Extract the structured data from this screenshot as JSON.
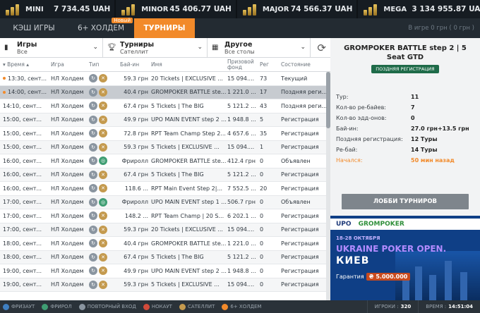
{
  "jackpots": [
    {
      "name": "MINI",
      "value": "7 734.45 UAH"
    },
    {
      "name": "MINOR",
      "value": "45 406.77 UAH"
    },
    {
      "name": "MAJOR",
      "value": "74 566.37 UAH"
    },
    {
      "name": "MEGA",
      "value": "3 134 955.87 UAH"
    }
  ],
  "tabs": [
    {
      "label": "КЭШ ИГРЫ"
    },
    {
      "label": "6+ ХОЛДЕМ",
      "badge": "Новый"
    },
    {
      "label": "ТУРНИРЫ"
    }
  ],
  "in_game": "В игре 0 грн  ( 0 грн )",
  "filters": {
    "games": {
      "title": "Игры",
      "value": "Все"
    },
    "tournaments": {
      "title": "Турниры",
      "value": "Сателлит"
    },
    "other": {
      "title": "Другое",
      "value": "Все столы"
    }
  },
  "columns": {
    "time": "▾ Время ▴",
    "game": "Игра",
    "type": "Тип",
    "buyin": "Бай-ин",
    "name": "Имя",
    "prize": "Призовой фонд",
    "reg": "Рег",
    "status": "Состояние"
  },
  "rows": [
    {
      "time": "13:30, сент...",
      "game": "НЛ Холдем",
      "buyin": "59.3 грн",
      "name": "20 Tickets | EXCLUSIVE ...",
      "prize": "15 094....",
      "reg": "73",
      "status": "Текущий",
      "dot": true
    },
    {
      "time": "14:00, сент...",
      "game": "НЛ Холдем",
      "buyin": "40.4 грн",
      "name": "GROMPOKER BATTLE ste...",
      "prize": "1 221.0 ...",
      "reg": "17",
      "status": "Поздняя реги...",
      "dot": true
    },
    {
      "time": "14:10, сент...",
      "game": "НЛ Холдем",
      "buyin": "67.4 грн",
      "name": "5 Tickets | The BIG",
      "prize": "5 121.2 ...",
      "reg": "43",
      "status": "Поздняя реги..."
    },
    {
      "time": "15:00, сент...",
      "game": "НЛ Холдем",
      "buyin": "49.9 грн",
      "name": "UPO MAIN EVENT step 2 ...",
      "prize": "1 948.8 ...",
      "reg": "5",
      "status": "Регистрация"
    },
    {
      "time": "15:00, сент...",
      "game": "НЛ Холдем",
      "buyin": "72.8 грн",
      "name": "RPT Team Champ Step 2...",
      "prize": "4 657.6 ...",
      "reg": "35",
      "status": "Регистрация"
    },
    {
      "time": "15:00, сент...",
      "game": "НЛ Холдем",
      "buyin": "59.3 грн",
      "name": "5 Tickets | EXCLUSIVE ...",
      "prize": "15 094....",
      "reg": "1",
      "status": "Регистрация"
    },
    {
      "time": "16:00, сент...",
      "game": "НЛ Холдем",
      "buyin": "Фриролл",
      "name": "GROMPOKER BATTLE ste...",
      "prize": "412.4 грн",
      "reg": "0",
      "status": "Объявлен"
    },
    {
      "time": "16:00, сент...",
      "game": "НЛ Холдем",
      "buyin": "67.4 грн",
      "name": "5 Tickets | The BIG",
      "prize": "5 121.2 ...",
      "reg": "0",
      "status": "Регистрация"
    },
    {
      "time": "16:00, сент...",
      "game": "НЛ Холдем",
      "buyin": "118.6 ...",
      "name": "RPT Main Event Step 2|...",
      "prize": "7 552.5 ...",
      "reg": "20",
      "status": "Регистрация"
    },
    {
      "time": "17:00, сент...",
      "game": "НЛ Холдем",
      "buyin": "Фриролл",
      "name": "UPO MAIN EVENT step 1 ...",
      "prize": "506.7 грн",
      "reg": "0",
      "status": "Объявлен"
    },
    {
      "time": "17:00, сент...",
      "game": "НЛ Холдем",
      "buyin": "148.2 ...",
      "name": "RPT Team Champ | 20 S...",
      "prize": "6 202.1 ...",
      "reg": "0",
      "status": "Регистрация"
    },
    {
      "time": "17:00, сент...",
      "game": "НЛ Холдем",
      "buyin": "59.3 грн",
      "name": "20 Tickets | EXCLUSIVE ...",
      "prize": "15 094....",
      "reg": "0",
      "status": "Регистрация"
    },
    {
      "time": "18:00, сент...",
      "game": "НЛ Холдем",
      "buyin": "40.4 грн",
      "name": "GROMPOKER BATTLE ste...",
      "prize": "1 221.0 ...",
      "reg": "0",
      "status": "Регистрация"
    },
    {
      "time": "18:00, сент...",
      "game": "НЛ Холдем",
      "buyin": "67.4 грн",
      "name": "5 Tickets | The BIG",
      "prize": "5 121.2 ...",
      "reg": "0",
      "status": "Регистрация"
    },
    {
      "time": "19:00, сент...",
      "game": "НЛ Холдем",
      "buyin": "49.9 грн",
      "name": "UPO MAIN EVENT step 2 ...",
      "prize": "1 948.8 ...",
      "reg": "0",
      "status": "Регистрация"
    },
    {
      "time": "19:00, сент...",
      "game": "НЛ Холдем",
      "buyin": "59.3 грн",
      "name": "5 Tickets | EXCLUSIVE ...",
      "prize": "15 094....",
      "reg": "0",
      "status": "Регистрация"
    }
  ],
  "details": {
    "title": "GROMPOKER BATTLE step 2 | 5 Seat GTD",
    "badge": "ПОЗДНЯЯ РЕГИСТРАЦИЯ",
    "info": [
      {
        "k": "Тур:",
        "v": "11"
      },
      {
        "k": "Кол-во ре-байев:",
        "v": "7"
      },
      {
        "k": "Кол-во эдд-онов:",
        "v": "0"
      },
      {
        "k": "Бай-ин:",
        "v": "27.0 грн+13.5 грн"
      },
      {
        "k": "Поздняя регистрация:",
        "v": "12 Туры"
      },
      {
        "k": "Ре-бай:",
        "v": "14 Туры"
      },
      {
        "k": "Начался:",
        "v": "50 мин назад"
      }
    ],
    "lobby_label": "ЛОББИ ТУРНИРОВ"
  },
  "banner": {
    "upo": "UPO",
    "gp": "GROMPOKER",
    "date": "18-28 ОКТЯБРЯ",
    "title": "UKRAINE POKER OPEN.",
    "city": "КИЕВ",
    "prize_label": "Гарантия",
    "prize": "₴ 5.000.000"
  },
  "footer": {
    "legend": [
      "ФРИЗАУТ",
      "ФРИРОЛ",
      "ПОВТОРНЫЙ ВХОД",
      "НОКАУТ",
      "САТЕЛЛИТ",
      "6+ ХОЛДЕМ"
    ],
    "players_label": "ИГРОКИ :",
    "players": "320",
    "time_label": "ВРЕМЯ :",
    "time": "14:51:04"
  },
  "colors": {
    "accent": "#f28a2a",
    "dark": "#1b2228",
    "green": "#1f6b49"
  }
}
